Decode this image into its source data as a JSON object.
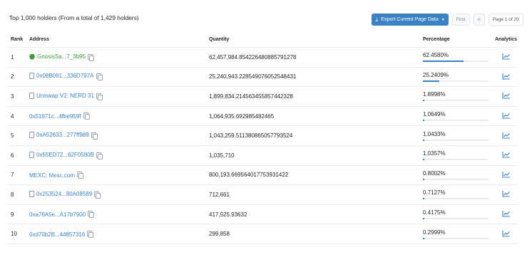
{
  "summary": "Top 1,000 holders (From a total of 1,429 holders)",
  "toolbar": {
    "export_label": "Export Current Page Data",
    "first_label": "First",
    "prev_label": "<",
    "page_info": "Page 1 of 20"
  },
  "columns": {
    "rank": "Rank",
    "address": "Address",
    "quantity": "Quantity",
    "percentage": "Percentage",
    "analytics": "Analytics"
  },
  "colors": {
    "accent": "#3b82c4",
    "green": "#3d9a3d"
  },
  "rows": [
    {
      "rank": "1",
      "address": "GnosisSa...7_3b95",
      "icon": "gnosis-safe-icon",
      "quantity": "62,457,984.854226480885791278",
      "pct": "62.4580%",
      "pct_value": 62.458
    },
    {
      "rank": "2",
      "address": "0x08B091...336D797A",
      "icon": "contract-icon",
      "quantity": "25,240,943.228549076052548431",
      "pct": "25.2409%",
      "pct_value": 25.2409
    },
    {
      "rank": "3",
      "address": "Uniswap V2: NERD 31",
      "icon": "contract-icon",
      "quantity": "1,899,834.214563455857442328",
      "pct": "1.8998%",
      "pct_value": 1.8998
    },
    {
      "rank": "4",
      "address": "0x51971c...4fbe959f",
      "icon": "",
      "quantity": "1,064,935.692985482465",
      "pct": "1.0649%",
      "pct_value": 1.0649
    },
    {
      "rank": "5",
      "address": "0xA52633...277ff989",
      "icon": "contract-icon",
      "quantity": "1,043,259.511380865057793524",
      "pct": "1.0433%",
      "pct_value": 1.0433
    },
    {
      "rank": "6",
      "address": "0x55ED72...62F0580B",
      "icon": "contract-icon",
      "quantity": "1,035,710",
      "pct": "1.0357%",
      "pct_value": 1.0357
    },
    {
      "rank": "7",
      "address": "MEXC: Mexc.com",
      "icon": "",
      "quantity": "800,193.669564017753931422",
      "pct": "0.8002%",
      "pct_value": 0.8002
    },
    {
      "rank": "8",
      "address": "0x253524...80A08589",
      "icon": "contract-icon",
      "quantity": "712,661",
      "pct": "0.7127%",
      "pct_value": 0.7127
    },
    {
      "rank": "9",
      "address": "0xa76A5e...A17b7900",
      "icon": "",
      "quantity": "417,525.93632",
      "pct": "0.4175%",
      "pct_value": 0.4175
    },
    {
      "rank": "10",
      "address": "0xd70b2B...44857316",
      "icon": "",
      "quantity": "299,858",
      "pct": "0.2999%",
      "pct_value": 0.2999
    }
  ]
}
